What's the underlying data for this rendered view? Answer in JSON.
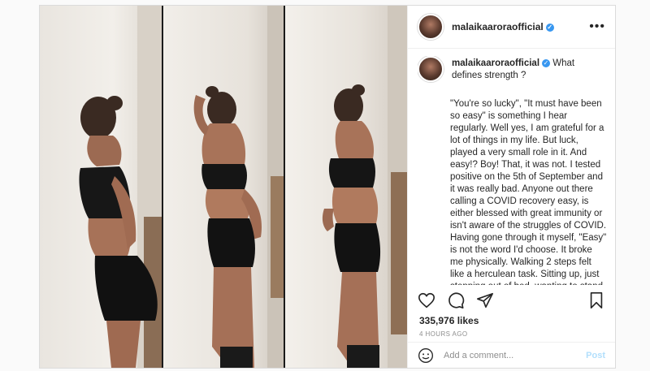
{
  "post": {
    "username": "malaikaaroraofficial",
    "verified_icon": "verified-badge-icon",
    "caption_first": "What defines strength ?",
    "caption_body": "\"You're so lucky\", \"It must have been so easy\" is something I hear regularly. Well yes, I am grateful for a lot of things in my life. But luck, played a very small role in it. And easy!? Boy! That, it was not. I tested positive on the 5th of September and it was really bad. Anyone out there calling a COVID recovery easy, is either blessed with great immunity or isn't aware of the struggles of COVID. Having gone through it myself, \"Easy\" is not the word I'd choose. It broke me physically. Walking 2 steps felt like a herculean task. Sitting up, just stepping out of bed, wanting to stand in my window was a journey in itself. I",
    "likes": "335,976 likes",
    "timestamp": "4 HOURS AGO"
  },
  "comment": {
    "placeholder": "Add a comment...",
    "post_label": "Post"
  },
  "colors": {
    "accent": "#3897f0",
    "post_button_disabled": "#b2dffc"
  }
}
